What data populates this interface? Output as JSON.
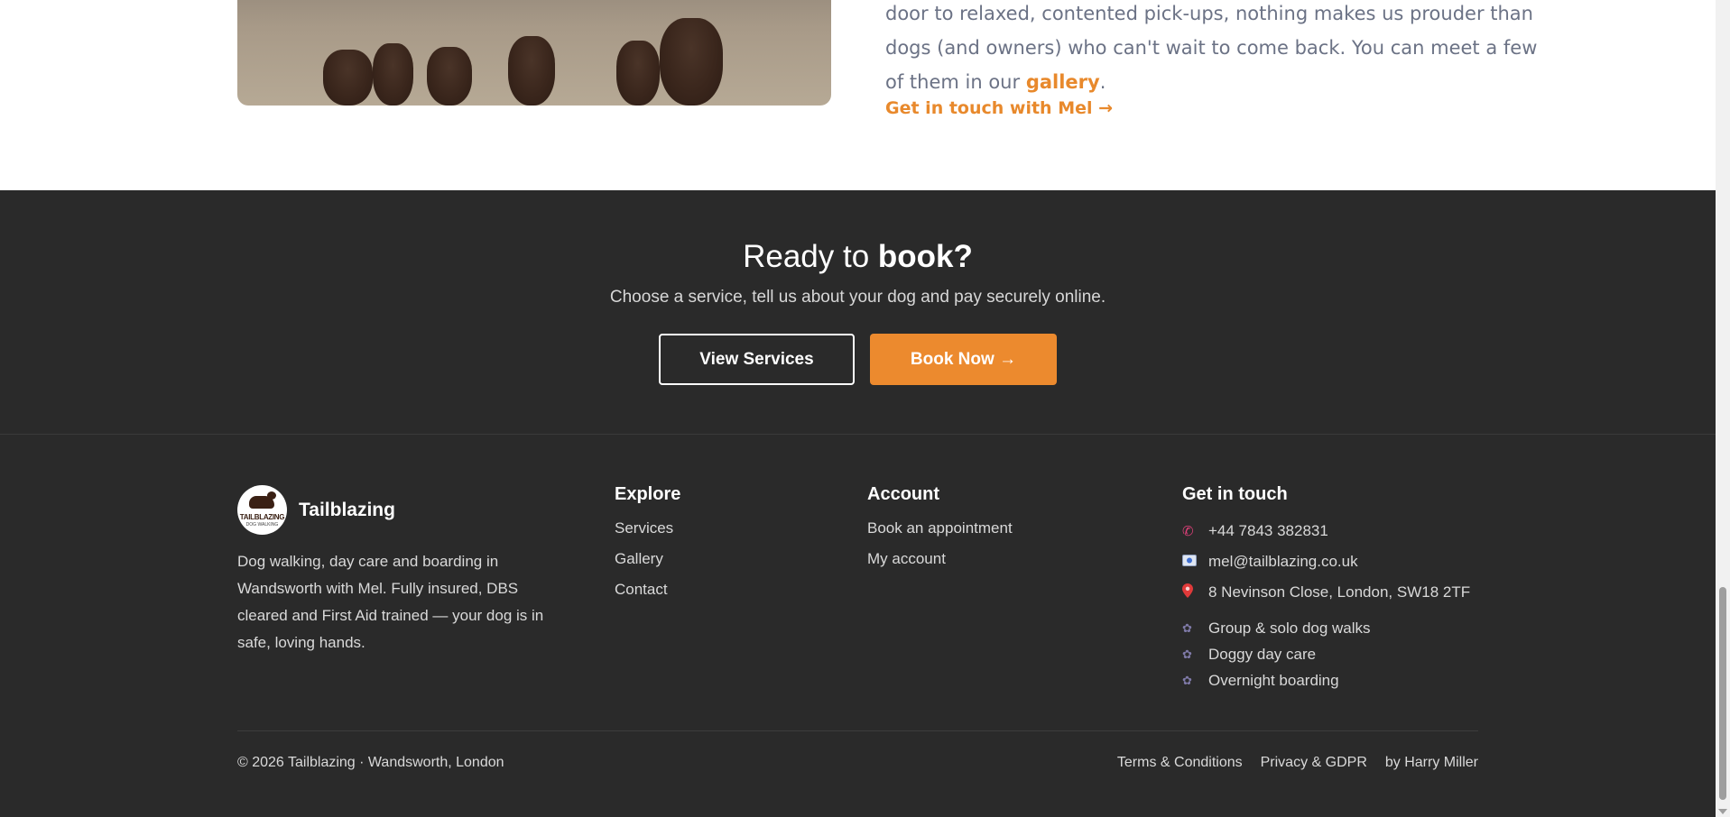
{
  "about": {
    "text_line_1": "door to relaxed, contented pick-ups, nothing makes us prouder than",
    "text_line_2": "dogs (and owners) who can't wait to come back. You can meet a few",
    "text_line_3_before": "of them in our ",
    "gallery_link": "gallery",
    "text_line_3_after": ".",
    "cta_link": "Get in touch with Mel →"
  },
  "booking": {
    "heading_light": "Ready to ",
    "heading_bold": "book?",
    "subtitle": "Choose a service, tell us about your dog and pay securely online.",
    "view_services_label": "View Services",
    "book_now_label": "Book Now →"
  },
  "footer": {
    "brand_name": "Tailblazing",
    "logo_text": "TAILBLAZING",
    "logo_subtext": "DOG WALKING",
    "description_lines": [
      "Dog walking, day care and boarding in",
      "Wandsworth with Mel. Fully insured, DBS",
      "cleared and First Aid trained — your dog is in",
      "safe, loving hands."
    ],
    "explore": {
      "heading": "Explore",
      "links": [
        "Services",
        "Gallery",
        "Contact"
      ]
    },
    "account": {
      "heading": "Account",
      "links": [
        "Book an appointment",
        "My account"
      ]
    },
    "contact": {
      "heading": "Get in touch",
      "phone": "+44 7843 382831",
      "email": "mel@tailblazing.co.uk",
      "address": "8 Nevinson Close, London, SW18 2TF",
      "services": [
        "Group & solo dog walks",
        "Doggy day care",
        "Overnight boarding"
      ]
    },
    "copyright": "© 2026 Tailblazing · Wandsworth, London",
    "legal": {
      "terms": "Terms & Conditions",
      "privacy": "Privacy & GDPR",
      "credit": "by Harry Miller"
    }
  },
  "icons": {
    "phone": "phone-icon",
    "email": "email-icon",
    "address": "map-pin-icon",
    "service": "paw-icon"
  },
  "colors": {
    "accent": "#e8892c",
    "dark_bg": "#2a2a2a",
    "body_text": "#6b7285"
  }
}
